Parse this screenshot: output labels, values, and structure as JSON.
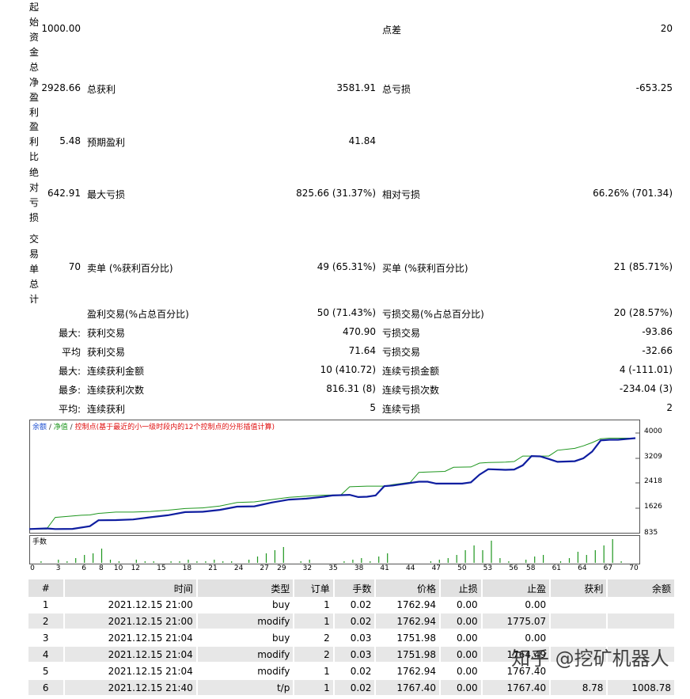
{
  "summary": {
    "initial_deposit": {
      "label": "起始资金",
      "value": "1000.00"
    },
    "spread": {
      "label": "点差",
      "value": "20"
    },
    "total_net_profit": {
      "label": "总净盈利",
      "value": "2928.66"
    },
    "gross_profit": {
      "label": "总获利",
      "value": "3581.91"
    },
    "gross_loss": {
      "label": "总亏损",
      "value": "-653.25"
    },
    "profit_factor": {
      "label": "盈利比",
      "value": "5.48"
    },
    "expected_payoff": {
      "label": "预期盈利",
      "value": "41.84"
    },
    "absolute_drawdown": {
      "label": "绝对亏损",
      "value": "642.91"
    },
    "maximal_drawdown": {
      "label": "最大亏损",
      "value": "825.66 (31.37%)"
    },
    "relative_drawdown": {
      "label": "相对亏损",
      "value": "66.26% (701.34)"
    },
    "total_trades": {
      "label": "交易单总计",
      "value": "70"
    },
    "short_positions": {
      "label": "卖单 (%获利百分比)",
      "value": "49 (65.31%)"
    },
    "long_positions": {
      "label": "买单 (%获利百分比)",
      "value": "21 (85.71%)"
    },
    "profit_trades": {
      "label": "盈利交易(%占总百分比)",
      "value": "50 (71.43%)"
    },
    "loss_trades": {
      "label": "亏损交易(%占总百分比)",
      "value": "20 (28.57%)"
    },
    "largest": {
      "prefix": "最大:",
      "profit_label": "获利交易",
      "profit_value": "470.90",
      "loss_label": "亏损交易",
      "loss_value": "-93.86"
    },
    "average": {
      "prefix": "平均",
      "profit_label": "获利交易",
      "profit_value": "71.64",
      "loss_label": "亏损交易",
      "loss_value": "-32.66"
    },
    "max_consecutive": {
      "prefix": "最大:",
      "win_label": "连续获利金额",
      "win_value": "10 (410.72)",
      "loss_label": "连续亏损金额",
      "loss_value": "4 (-111.01)"
    },
    "maximal_consecutive": {
      "prefix": "最多:",
      "win_label": "连续获利次数",
      "win_value": "816.31 (8)",
      "loss_label": "连续亏损次数",
      "loss_value": "-234.04 (3)"
    },
    "average_consecutive": {
      "prefix": "平均:",
      "win_label": "连续获利",
      "win_value": "5",
      "loss_label": "连续亏损",
      "loss_value": "2"
    }
  },
  "chart_data": {
    "type": "line",
    "legend": {
      "balance": "余额",
      "equity": "净值",
      "points": "控制点(基于最近的小一级时段内的12个控制点的分形插值计算)",
      "sep": " / "
    },
    "colors": {
      "balance": "#0f1ea0",
      "equity": "#1e961e",
      "points": "#e01010",
      "volume": "#1e961e",
      "balance_legend": "#1d4fd1"
    },
    "ylim": [
      835,
      4000
    ],
    "y_ticks": [
      "4000",
      "3209",
      "2418",
      "1626",
      "835"
    ],
    "x_ticks": [
      "0",
      "3",
      "6",
      "8",
      "10",
      "12",
      "15",
      "18",
      "21",
      "24",
      "27",
      "29",
      "32",
      "35",
      "38",
      "41",
      "44",
      "47",
      "50",
      "53",
      "56",
      "58",
      "61",
      "64",
      "67",
      "70"
    ],
    "xlim": [
      0,
      70
    ],
    "series": [
      {
        "name": "余额",
        "x": [
          0,
          2,
          3,
          5,
          7,
          8,
          10,
          12,
          14,
          16,
          18,
          20,
          22,
          24,
          26,
          28,
          30,
          32,
          34,
          35,
          37,
          38,
          39,
          40,
          41,
          42,
          43,
          45,
          46,
          47,
          48,
          50,
          51,
          52,
          53,
          55,
          56,
          57,
          58,
          59,
          60,
          61,
          63,
          64,
          65,
          66,
          67,
          68,
          70
        ],
        "y": [
          1000,
          1020,
          1000,
          1005,
          1090,
          1275,
          1280,
          1300,
          1370,
          1430,
          1530,
          1540,
          1600,
          1700,
          1710,
          1830,
          1920,
          1950,
          2010,
          2050,
          2070,
          2000,
          2010,
          2050,
          2340,
          2360,
          2400,
          2480,
          2480,
          2420,
          2420,
          2420,
          2460,
          2700,
          2870,
          2850,
          2860,
          2990,
          3280,
          3270,
          3190,
          3100,
          3120,
          3210,
          3420,
          3770,
          3790,
          3790,
          3840
        ]
      },
      {
        "name": "净值",
        "x": [
          0,
          2,
          3,
          6,
          7,
          8,
          10,
          12,
          14,
          16,
          18,
          20,
          22,
          24,
          26,
          28,
          30,
          32,
          34,
          36,
          37,
          38,
          39,
          41,
          42,
          44,
          45,
          46,
          47,
          48,
          49,
          51,
          52,
          53,
          55,
          56,
          57,
          59,
          60,
          61,
          63,
          64,
          65,
          66,
          67,
          68,
          70
        ],
        "y": [
          1000,
          1000,
          1365,
          1430,
          1440,
          1490,
          1530,
          1530,
          1550,
          1590,
          1640,
          1660,
          1720,
          1830,
          1850,
          1920,
          1990,
          2030,
          2060,
          2070,
          2320,
          2330,
          2340,
          2340,
          2390,
          2460,
          2770,
          2780,
          2790,
          2800,
          2930,
          2940,
          3060,
          3080,
          3090,
          3110,
          3280,
          3280,
          3280,
          3460,
          3520,
          3600,
          3700,
          3820,
          3840,
          3840,
          3840
        ]
      }
    ],
    "volume": {
      "label": "手数",
      "x": [
        1,
        3,
        4,
        5,
        6,
        7,
        8,
        9,
        10,
        12,
        13,
        14,
        16,
        17,
        18,
        19,
        20,
        21,
        22,
        23,
        25,
        26,
        27,
        28,
        29,
        31,
        32,
        36,
        37,
        38,
        39,
        40,
        41,
        46,
        47,
        48,
        49,
        50,
        51,
        52,
        53,
        54,
        55,
        57,
        58,
        59,
        61,
        62,
        63,
        64,
        65,
        66,
        67,
        68
      ],
      "y": [
        0.02,
        0.04,
        0.02,
        0.06,
        0.1,
        0.12,
        0.18,
        0.04,
        0.02,
        0.04,
        0.02,
        0.02,
        0.02,
        0.02,
        0.04,
        0.02,
        0.02,
        0.04,
        0.02,
        0.02,
        0.04,
        0.08,
        0.12,
        0.16,
        0.2,
        0.02,
        0.04,
        0.02,
        0.04,
        0.06,
        0.02,
        0.08,
        0.12,
        0.02,
        0.04,
        0.06,
        0.1,
        0.16,
        0.22,
        0.16,
        0.28,
        0.06,
        0.02,
        0.04,
        0.08,
        0.1,
        0.02,
        0.06,
        0.14,
        0.1,
        0.16,
        0.22,
        0.3,
        0.02
      ]
    }
  },
  "trades": {
    "headers": [
      "#",
      "时间",
      "类型",
      "订单",
      "手数",
      "价格",
      "止损",
      "止盈",
      "获利",
      "余额"
    ],
    "rows": [
      [
        "1",
        "2021.12.15 21:00",
        "buy",
        "1",
        "0.02",
        "1762.94",
        "0.00",
        "0.00",
        "",
        ""
      ],
      [
        "2",
        "2021.12.15 21:00",
        "modify",
        "1",
        "0.02",
        "1762.94",
        "0.00",
        "1775.07",
        "",
        ""
      ],
      [
        "3",
        "2021.12.15 21:04",
        "buy",
        "2",
        "0.03",
        "1751.98",
        "0.00",
        "0.00",
        "",
        ""
      ],
      [
        "4",
        "2021.12.15 21:04",
        "modify",
        "2",
        "0.03",
        "1751.98",
        "0.00",
        "1764.49",
        "",
        ""
      ],
      [
        "5",
        "2021.12.15 21:04",
        "modify",
        "1",
        "0.02",
        "1762.94",
        "0.00",
        "1767.40",
        "",
        ""
      ],
      [
        "6",
        "2021.12.15 21:40",
        "t/p",
        "1",
        "0.02",
        "1767.40",
        "0.00",
        "1767.40",
        "8.78",
        "1008.78"
      ]
    ]
  },
  "watermark": "知乎 @挖矿机器人"
}
